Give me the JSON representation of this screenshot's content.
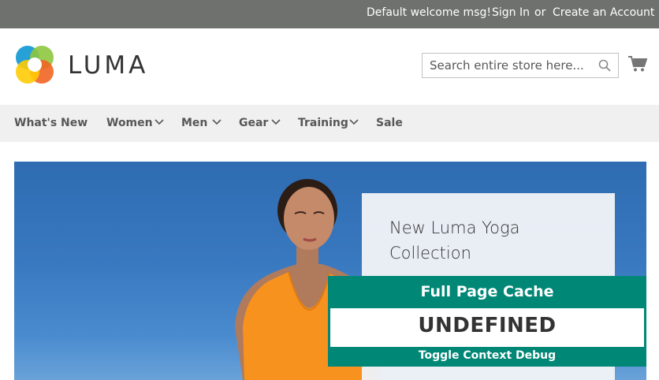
{
  "topbar": {
    "welcome": "Default welcome msg!",
    "sign_in": "Sign In",
    "or": "or",
    "create_account": "Create an Account"
  },
  "header": {
    "logo_text": "LUMA",
    "search_placeholder": "Search entire store here...",
    "search_value": ""
  },
  "nav": {
    "items": [
      {
        "label": "What's New",
        "dropdown": false
      },
      {
        "label": "Women",
        "dropdown": true
      },
      {
        "label": "Men",
        "dropdown": true
      },
      {
        "label": "Gear",
        "dropdown": true
      },
      {
        "label": "Training",
        "dropdown": true
      },
      {
        "label": "Sale",
        "dropdown": false
      }
    ]
  },
  "hero": {
    "title": "New Luma Yoga Collection"
  },
  "debug": {
    "title": "Full Page Cache",
    "status": "UNDEFINED",
    "toggle": "Toggle Context Debug"
  },
  "colors": {
    "topbar": "#6e716e",
    "nav_bg": "#f0f0f0",
    "debug_accent": "#008776",
    "hero_sky": "#3878bf"
  }
}
